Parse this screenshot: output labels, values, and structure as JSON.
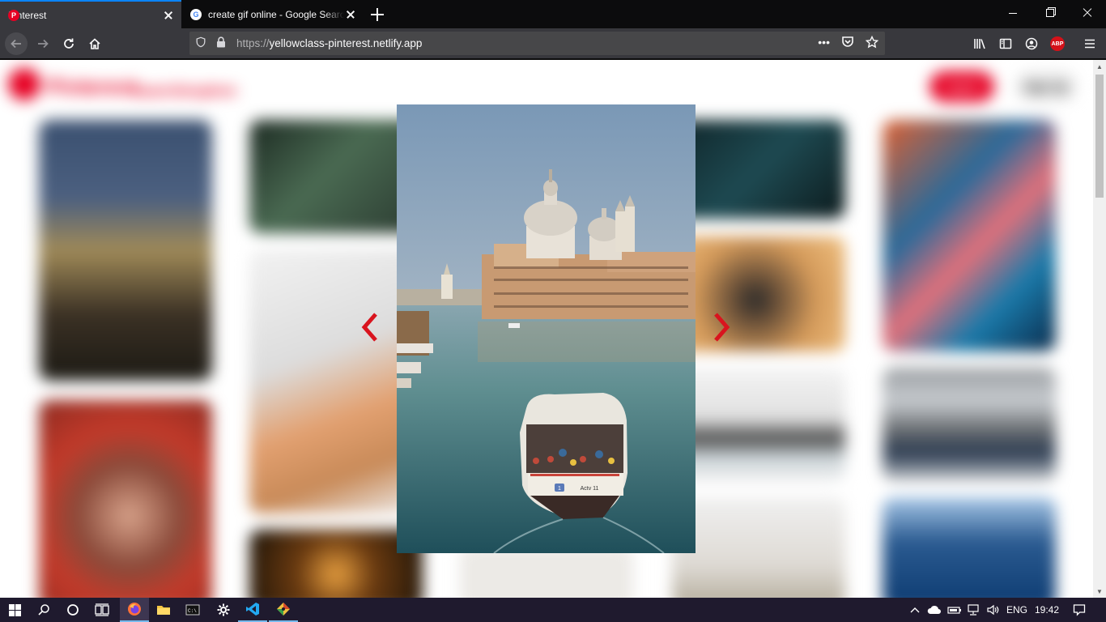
{
  "browser": {
    "tabs": [
      {
        "title": "Pinterest",
        "favicon": "pinterest-icon",
        "active": true
      },
      {
        "title": "create gif online - Google Search",
        "favicon": "google-icon",
        "active": false
      }
    ],
    "new_tab_label": "+",
    "url_scheme": "https://",
    "url_host": "yellowclass-pinterest.netlify.app",
    "toolbar_icons": [
      "library-icon",
      "sidebar-icon",
      "account-icon",
      "adblock-plus-icon",
      "menu-icon"
    ],
    "abp_label": "ABP"
  },
  "page": {
    "logo_text": "Pinterest",
    "logo_subtitle": "search/explore",
    "login_label": "Log in",
    "signup_label": "Sign Up",
    "modal": {
      "image_subject": "Venice Grand Canal with Santa Maria della Salute and vaporetto",
      "boat_label": "Actv 11",
      "boat_number": "1"
    }
  },
  "taskbar": {
    "apps": [
      "start-icon",
      "search-icon",
      "cortana-icon",
      "task-view-icon",
      "firefox-icon",
      "file-explorer-icon",
      "terminal-icon",
      "settings-icon",
      "vscode-icon",
      "git-icon"
    ],
    "language": "ENG",
    "time": "19:42"
  },
  "colors": {
    "pinterest_red": "#e60023",
    "chrome_dark": "#0c0c0d",
    "toolbar": "#38383d",
    "taskbar": "#1f1a2e"
  }
}
